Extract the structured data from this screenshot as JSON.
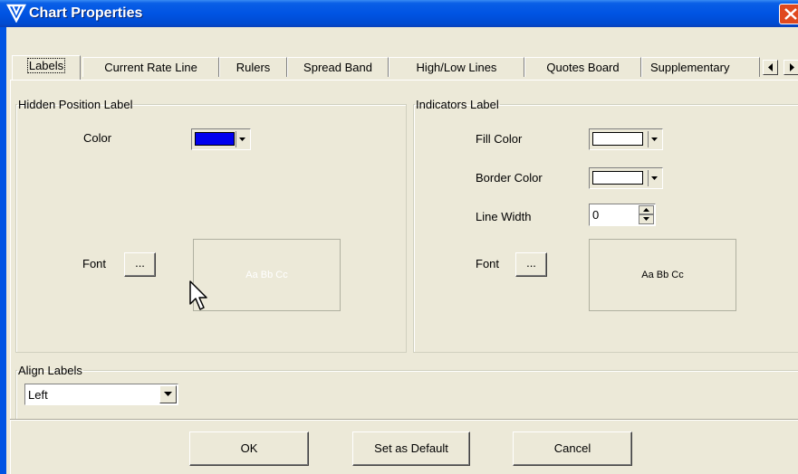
{
  "window": {
    "title": "Chart Properties",
    "titlebar_color": "#0054e3"
  },
  "tabs": [
    {
      "label": "Labels",
      "active": true
    },
    {
      "label": "Current Rate Line"
    },
    {
      "label": "Rulers"
    },
    {
      "label": "Spread Band"
    },
    {
      "label": "High/Low Lines"
    },
    {
      "label": "Quotes Board"
    },
    {
      "label": "Supplementary"
    }
  ],
  "hidden_position_label": {
    "legend": "Hidden Position Label",
    "color_label": "Color",
    "color_value": "#0000ee",
    "font_label": "Font",
    "font_button": "...",
    "preview_text": "Aa Bb Cc"
  },
  "indicators_label": {
    "legend": "Indicators Label",
    "fill_color_label": "Fill Color",
    "fill_color_value": "#ffffff",
    "border_color_label": "Border Color",
    "border_color_value": "#ffffff",
    "line_width_label": "Line Width",
    "line_width_value": "0",
    "font_label": "Font",
    "font_button": "...",
    "preview_text": "Aa Bb Cc"
  },
  "align_labels": {
    "legend": "Align Labels",
    "selected": "Left"
  },
  "buttons": {
    "ok": "OK",
    "set_default": "Set as Default",
    "cancel": "Cancel"
  }
}
